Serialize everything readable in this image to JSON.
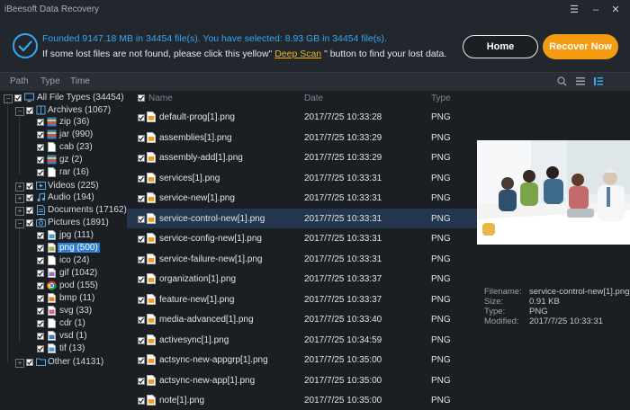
{
  "window": {
    "title": "iBeesoft Data Recovery"
  },
  "header": {
    "found_text": "Founded 9147.18 MB in 34454 file(s).  You have selected: 8.93 GB in 34454 file(s).",
    "hint_before": "If some lost files are not found, please click this yellow\"",
    "deep_scan_label": "Deep Scan",
    "hint_after": "\" button to find your lost data.",
    "home_label": "Home",
    "recover_label": "Recover Now"
  },
  "tabs": {
    "path": "Path",
    "type": "Type",
    "time": "Time"
  },
  "tree": {
    "root": "All File Types (34454)",
    "archives": "Archives (1067)",
    "zip": "zip (36)",
    "jar": "jar (990)",
    "cab": "cab (23)",
    "gz": "gz (2)",
    "rar": "rar (16)",
    "videos": "Videos (225)",
    "audio": "Audio (194)",
    "documents": "Documents (17162)",
    "pictures": "Pictures (1891)",
    "jpg": "jpg (111)",
    "png": "png (500)",
    "ico": "ico (24)",
    "gif": "gif (1042)",
    "pod": "pod (155)",
    "bmp": "bmp (11)",
    "svg": "svg (33)",
    "cdr": "cdr (1)",
    "vsd": "vsd (1)",
    "tif": "tif (13)",
    "other": "Other (14131)"
  },
  "list": {
    "col_name": "Name",
    "col_date": "Date",
    "col_type": "Type",
    "rows": [
      {
        "name": "default-prog[1].png",
        "date": "2017/7/25  10:33:28",
        "type": "PNG"
      },
      {
        "name": "assemblies[1].png",
        "date": "2017/7/25  10:33:29",
        "type": "PNG"
      },
      {
        "name": "assembly-add[1].png",
        "date": "2017/7/25  10:33:29",
        "type": "PNG"
      },
      {
        "name": "services[1].png",
        "date": "2017/7/25  10:33:31",
        "type": "PNG"
      },
      {
        "name": "service-new[1].png",
        "date": "2017/7/25  10:33:31",
        "type": "PNG"
      },
      {
        "name": "service-control-new[1].png",
        "date": "2017/7/25  10:33:31",
        "type": "PNG"
      },
      {
        "name": "service-config-new[1].png",
        "date": "2017/7/25  10:33:31",
        "type": "PNG"
      },
      {
        "name": "service-failure-new[1].png",
        "date": "2017/7/25  10:33:31",
        "type": "PNG"
      },
      {
        "name": "organization[1].png",
        "date": "2017/7/25  10:33:37",
        "type": "PNG"
      },
      {
        "name": "feature-new[1].png",
        "date": "2017/7/25  10:33:37",
        "type": "PNG"
      },
      {
        "name": "media-advanced[1].png",
        "date": "2017/7/25  10:33:40",
        "type": "PNG"
      },
      {
        "name": "activesync[1].png",
        "date": "2017/7/25  10:34:59",
        "type": "PNG"
      },
      {
        "name": "actsync-new-appgrp[1].png",
        "date": "2017/7/25  10:35:00",
        "type": "PNG"
      },
      {
        "name": "actsync-new-app[1].png",
        "date": "2017/7/25  10:35:00",
        "type": "PNG"
      },
      {
        "name": "note[1].png",
        "date": "2017/7/25  10:35:00",
        "type": "PNG"
      }
    ]
  },
  "preview": {
    "filename_label": "Filename:",
    "filename": "service-control-new[1].png",
    "size_label": "Size:",
    "size": "0.91 KB",
    "type_label": "Type:",
    "type": "PNG",
    "modified_label": "Modified:",
    "modified": "2017/7/25  10:33:31"
  },
  "colors": {
    "accent": "#35a7ef",
    "recover": "#f49b12",
    "selection": "#2f7fd1",
    "link": "#f6b31b"
  }
}
